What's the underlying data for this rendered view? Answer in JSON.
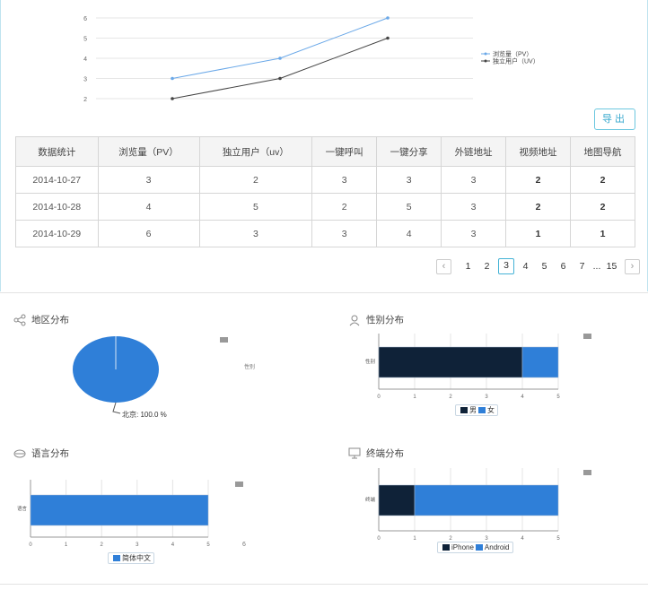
{
  "export_label": "导出",
  "line_chart": {
    "y_ticks": [
      "6",
      "5",
      "4",
      "3",
      "2"
    ],
    "series": [
      {
        "name": "浏览量（PV）",
        "color": "#6aa8e8",
        "values": [
          3,
          4,
          6
        ]
      },
      {
        "name": "独立用户（UV）",
        "color": "#444444",
        "values": [
          2,
          3,
          5
        ]
      }
    ]
  },
  "table": {
    "headers": [
      "数据统计",
      "浏览量（PV）",
      "独立用户（uv）",
      "一键呼叫",
      "一键分享",
      "外链地址",
      "视频地址",
      "地图导航"
    ],
    "rows": [
      [
        "2014-10-27",
        "3",
        "2",
        "3",
        "3",
        "3",
        "2",
        "2"
      ],
      [
        "2014-10-28",
        "4",
        "5",
        "2",
        "5",
        "3",
        "2",
        "2"
      ],
      [
        "2014-10-29",
        "6",
        "3",
        "3",
        "4",
        "3",
        "1",
        "1"
      ]
    ]
  },
  "pager": {
    "prev": "‹",
    "next": "›",
    "pages": [
      "1",
      "2",
      "3",
      "4",
      "5",
      "6",
      "7"
    ],
    "active": "3",
    "ellipsis": "...",
    "last": "15"
  },
  "region": {
    "title": "地区分布",
    "side_label": "性别",
    "pie_label": "北京: 100.0 %",
    "chart_data": {
      "type": "pie",
      "slices": [
        {
          "name": "北京",
          "value": 100.0
        }
      ]
    }
  },
  "gender": {
    "title": "性别分布",
    "category": "性别",
    "x_ticks": [
      "0",
      "1",
      "2",
      "3",
      "4",
      "5"
    ],
    "legend": [
      "男",
      "女"
    ],
    "colors": [
      "#0f2238",
      "#2f7fd8"
    ],
    "chart_data": {
      "type": "bar",
      "categories": [
        "性别"
      ],
      "series": [
        {
          "name": "男",
          "values": [
            4
          ]
        },
        {
          "name": "女",
          "values": [
            1
          ]
        }
      ],
      "xlim": [
        0,
        5
      ]
    }
  },
  "language": {
    "title": "语言分布",
    "category": "语言",
    "x_ticks": [
      "0",
      "1",
      "2",
      "3",
      "4",
      "5"
    ],
    "side_tick": "6",
    "legend": [
      "简体中文"
    ],
    "colors": [
      "#2f7fd8"
    ],
    "chart_data": {
      "type": "bar",
      "categories": [
        "语言"
      ],
      "series": [
        {
          "name": "简体中文",
          "values": [
            5
          ]
        }
      ],
      "xlim": [
        0,
        5
      ]
    }
  },
  "terminal": {
    "title": "终端分布",
    "category": "终端",
    "x_ticks": [
      "0",
      "1",
      "2",
      "3",
      "4",
      "5"
    ],
    "legend": [
      "iPhone",
      "Android"
    ],
    "colors": [
      "#0f2238",
      "#2f7fd8"
    ],
    "chart_data": {
      "type": "bar",
      "categories": [
        "终端"
      ],
      "series": [
        {
          "name": "iPhone",
          "values": [
            1
          ]
        },
        {
          "name": "Android",
          "values": [
            4
          ]
        }
      ],
      "xlim": [
        0,
        5
      ]
    }
  }
}
